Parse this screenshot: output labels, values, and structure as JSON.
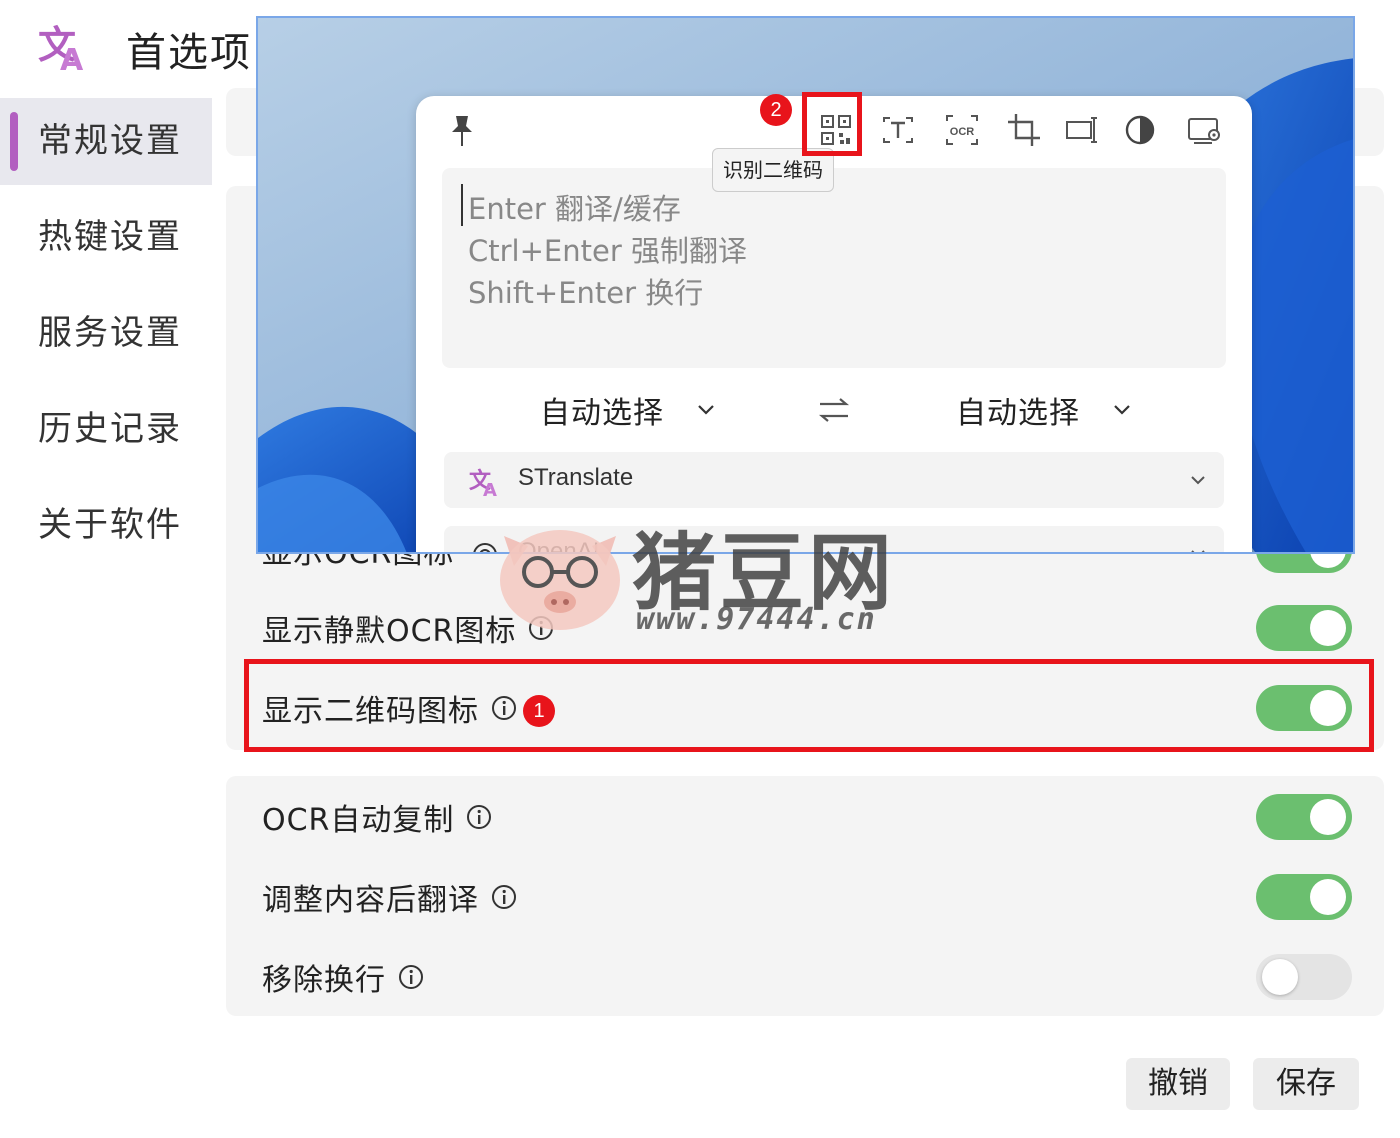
{
  "app": {
    "title": "首选项"
  },
  "sidebar": {
    "items": [
      {
        "label": "常规设置",
        "active": true
      },
      {
        "label": "热键设置",
        "active": false
      },
      {
        "label": "服务设置",
        "active": false
      },
      {
        "label": "历史记录",
        "active": false
      },
      {
        "label": "关于软件",
        "active": false
      }
    ]
  },
  "settings": {
    "partial_hidden": {
      "label": "显示OCR图标",
      "on": true
    },
    "silent_ocr_icon": {
      "label": "显示静默OCR图标",
      "on": true
    },
    "qrcode_icon": {
      "label": "显示二维码图标",
      "on": true
    },
    "ocr_auto_copy": {
      "label": "OCR自动复制",
      "on": true
    },
    "translate_after_adjust": {
      "label": "调整内容后翻译",
      "on": true
    },
    "remove_linebreak": {
      "label": "移除换行",
      "on": false
    }
  },
  "footer": {
    "cancel_label": "撤销",
    "save_label": "保存"
  },
  "annotations": {
    "badge_1": "1",
    "badge_2": "2"
  },
  "translator": {
    "tooltip": "识别二维码",
    "placeholder_lines": [
      "Enter 翻译/缓存",
      "Ctrl+Enter 强制翻译",
      "Shift+Enter 换行"
    ],
    "source_lang": "自动选择",
    "target_lang": "自动选择",
    "services": [
      {
        "name": "STranslate"
      },
      {
        "name": "OpenAI"
      }
    ],
    "toolbar_icons": [
      "pin-icon",
      "qrcode-icon",
      "text-ocr-icon",
      "ocr-icon",
      "crop-icon",
      "input-box-icon",
      "contrast-icon",
      "screen-settings-icon"
    ]
  },
  "watermark": {
    "text": "猪豆网",
    "url": "www.97444.cn"
  },
  "colors": {
    "accent": "#b25fc0",
    "toggle_on": "#6bbf6f",
    "highlight": "#e8141b"
  }
}
